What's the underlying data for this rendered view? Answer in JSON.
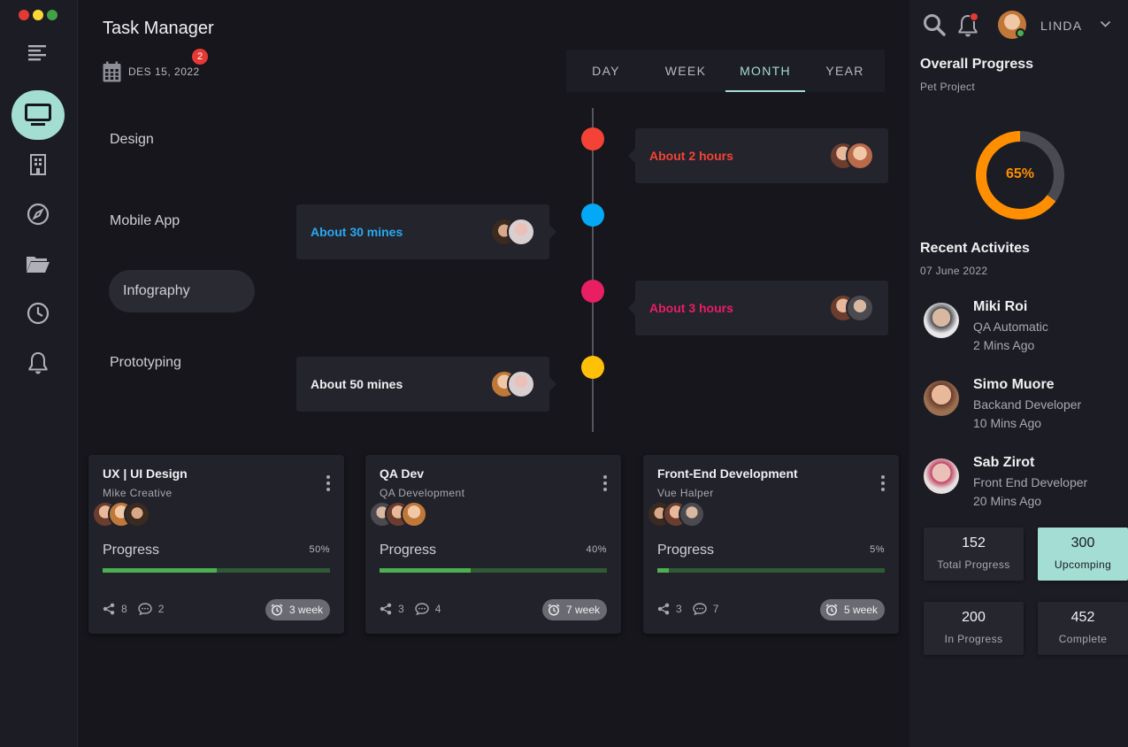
{
  "app": {
    "title": "Task Manager",
    "date": "DES 15, 2022",
    "date_badge": "2",
    "accent_color": "#a3ddd3"
  },
  "sidebar": {
    "traffic_lights": [
      "#e53935",
      "#fdd835",
      "#43a047"
    ],
    "items": [
      {
        "icon": "menu-icon",
        "active": false
      },
      {
        "icon": "monitor-icon",
        "active": true
      },
      {
        "icon": "building-icon",
        "active": false
      },
      {
        "icon": "compass-icon",
        "active": false
      },
      {
        "icon": "folder-icon",
        "active": false
      },
      {
        "icon": "clock-icon",
        "active": false
      },
      {
        "icon": "bell-icon",
        "active": false
      }
    ]
  },
  "period_tabs": [
    {
      "label": "DAY",
      "active": false
    },
    {
      "label": "WEEK",
      "active": false
    },
    {
      "label": "MONTH",
      "active": true
    },
    {
      "label": "YEAR",
      "active": false
    }
  ],
  "timeline": [
    {
      "label": "Design",
      "duration": "About 2 hours",
      "color": "#f44336",
      "side": "right",
      "highlighted": false
    },
    {
      "label": "Mobile App",
      "duration": "About 30 mines",
      "color": "#03a9f4",
      "side": "left",
      "highlighted": false
    },
    {
      "label": "Infography",
      "duration": "About 3 hours",
      "color": "#e91e63",
      "side": "right",
      "highlighted": true
    },
    {
      "label": "Prototyping",
      "duration": "About 50 mines",
      "color": "#ffc107",
      "side": "left",
      "highlighted": false
    }
  ],
  "projects": [
    {
      "title": "UX | UI Design",
      "subtitle": "Mike Creative",
      "progress_label": "Progress",
      "progress": "50%",
      "progress_value": 50,
      "shares": "8",
      "comments": "2",
      "time": "3 week"
    },
    {
      "title": "QA Dev",
      "subtitle": "QA Development",
      "progress_label": "Progress",
      "progress": "40%",
      "progress_value": 40,
      "shares": "3",
      "comments": "4",
      "time": "7 week"
    },
    {
      "title": "Front-End Development",
      "subtitle": "Vue Halper",
      "progress_label": "Progress",
      "progress": "5%",
      "progress_value": 5,
      "shares": "3",
      "comments": "7",
      "time": "5 week"
    }
  ],
  "header": {
    "user_name": "LINDA",
    "online_status_color": "#4caf50",
    "notification_dot_color": "#e53935"
  },
  "overall": {
    "title": "Overall Progress",
    "subtitle": "Pet Project",
    "percent_label": "65%",
    "percent_value": 65,
    "ring_color": "#ff8f00"
  },
  "activities": {
    "title": "Recent Activites",
    "date": "07 June 2022",
    "items": [
      {
        "name": "Miki Roi",
        "role": "QA Automatic",
        "time": "2 Mins Ago"
      },
      {
        "name": "Simo Muore",
        "role": "Backand Developer",
        "time": "10 Mins Ago"
      },
      {
        "name": "Sab Zirot",
        "role": "Front End Developer",
        "time": "20 Mins Ago"
      }
    ]
  },
  "stats": [
    {
      "value": "152",
      "label": "Total Progress",
      "highlight": false
    },
    {
      "value": "300",
      "label": "Upcomping",
      "highlight": true
    },
    {
      "value": "200",
      "label": "In Progress",
      "highlight": false
    },
    {
      "value": "452",
      "label": "Complete",
      "highlight": false
    }
  ]
}
